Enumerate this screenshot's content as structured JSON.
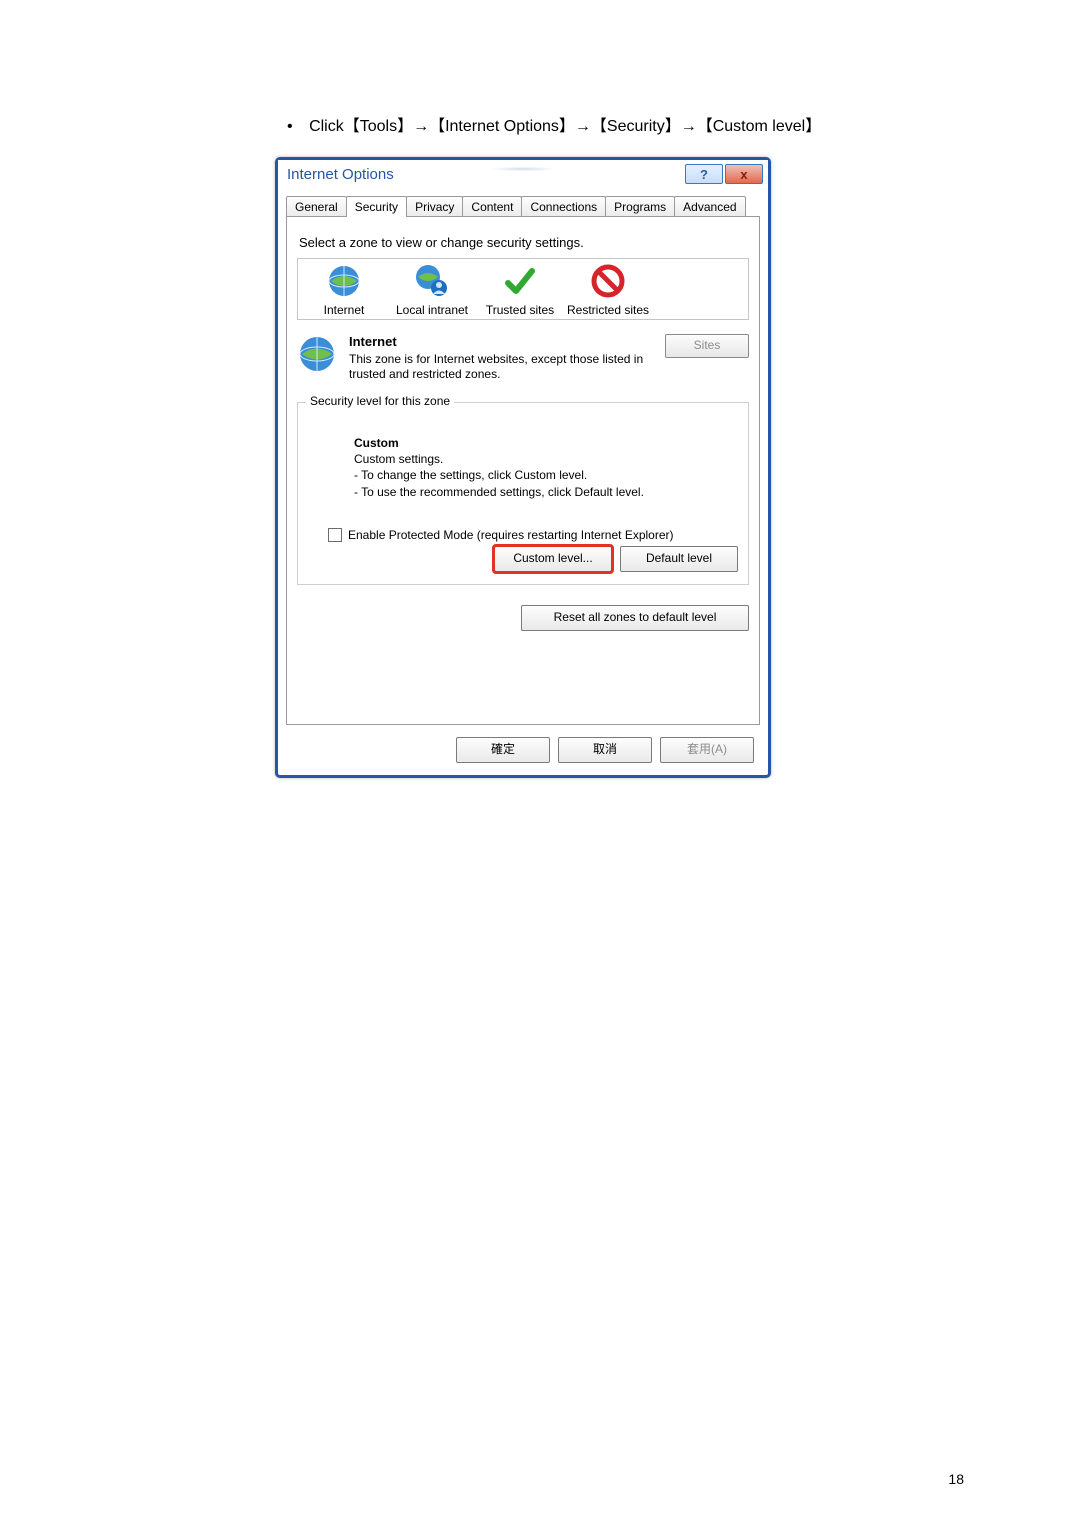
{
  "instruction": {
    "bullet": "•",
    "text": "Click【Tools】→【Internet Options】→【Security】→【Custom level】"
  },
  "dialog": {
    "title": "Internet Options",
    "help_glyph": "?",
    "close_glyph": "x",
    "tabs": [
      "General",
      "Security",
      "Privacy",
      "Content",
      "Connections",
      "Programs",
      "Advanced"
    ],
    "active_tab_index": 1,
    "zone_prompt": "Select a zone to view or change security settings.",
    "zones": [
      {
        "label": "Internet",
        "icon": "globe"
      },
      {
        "label": "Local intranet",
        "icon": "globe-user"
      },
      {
        "label": "Trusted sites",
        "icon": "check"
      },
      {
        "label": "Restricted sites",
        "icon": "no"
      }
    ],
    "selected_zone": {
      "name": "Internet",
      "desc": "This zone is for Internet websites, except those listed in trusted and restricted zones.",
      "sites_label": "Sites"
    },
    "group": {
      "legend": "Security level for this zone",
      "custom_heading": "Custom",
      "custom_sub": "Custom settings.",
      "custom_line1": "- To change the settings, click Custom level.",
      "custom_line2": "- To use the recommended settings, click Default level.",
      "protected_mode_label": "Enable Protected Mode (requires restarting Internet Explorer)",
      "custom_level_btn": "Custom level...",
      "default_level_btn": "Default level",
      "reset_btn": "Reset all zones to default level"
    },
    "footer": {
      "ok": "確定",
      "cancel": "取消",
      "apply": "套用(A)"
    }
  },
  "page_number": "18"
}
